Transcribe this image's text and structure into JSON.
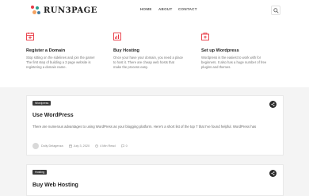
{
  "header": {
    "logo_text": "RUN3PAGE",
    "nav": [
      {
        "label": "HOME"
      },
      {
        "label": "ABOUT"
      },
      {
        "label": "CONTACT"
      }
    ],
    "search_icon": "search-icon"
  },
  "features": [
    {
      "icon": "register-icon",
      "title": "Register a Domain",
      "text": "Stop sitting on the sidelines and join the game! The first step of building a 3 page website is registering a domain name."
    },
    {
      "icon": "hosting-icon",
      "title": "Buy Hosting",
      "text": "Once your have your domain, you need a place to host it. There are cheap web hosts that make the process easy."
    },
    {
      "icon": "wordpress-setup-icon",
      "title": "Set up Wordpress",
      "text": "Wordpress is the easiest to work with for beginners. It also has a huge number of free plugins and themes."
    }
  ],
  "posts": [
    {
      "category": "Wordpress",
      "title": "Use WordPress",
      "excerpt": "There are numerous advantages to using WordPress as your blogging platform. Here's a short list of the top 7 that I've found helpful. WordPress has",
      "author": "Dolly Delagenza",
      "date": "July 3, 2020",
      "read_time": "4 Min Read",
      "comments": "0"
    },
    {
      "category": "Hosting",
      "title": "Buy Web Hosting"
    }
  ],
  "colors": {
    "accent_red": "#e8343f",
    "dark": "#222222",
    "tag_bg": "#3a3a3a"
  }
}
